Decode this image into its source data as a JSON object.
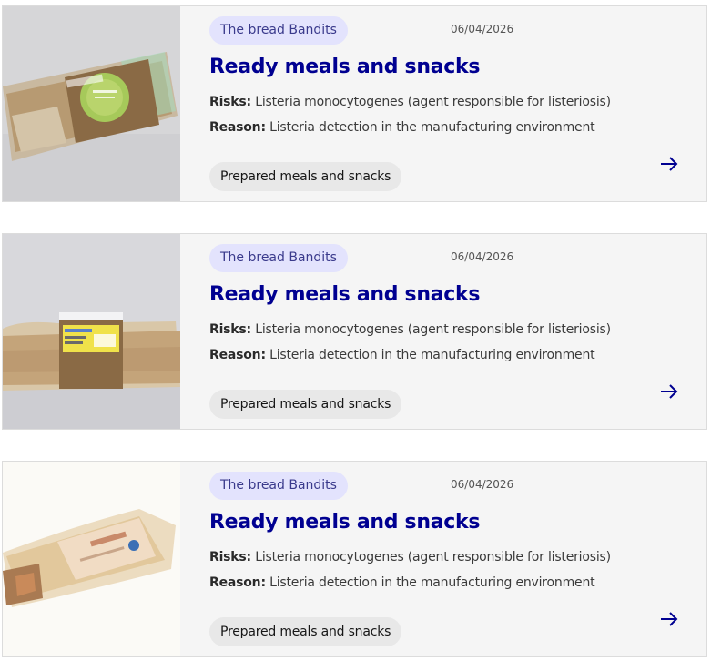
{
  "colors": {
    "card_bg": "#f5f5f5",
    "title": "#000091",
    "brand_badge_bg": "#e3e3fd",
    "tag_bg": "#e8e8e8"
  },
  "cards": [
    {
      "brand": "The bread Bandits",
      "date": "06/04/2026",
      "title": "Ready meals and snacks",
      "risks_label": "Risks:",
      "risks_text": " Listeria monocytogenes (agent responsible for listeriosis)",
      "reason_label": "Reason:",
      "reason_text": " Listeria detection in the manufacturing environment",
      "tag": "Prepared meals and snacks",
      "arrow_icon": "arrow-right-icon"
    },
    {
      "brand": "The bread Bandits",
      "date": "06/04/2026",
      "title": "Ready meals and snacks",
      "risks_label": "Risks:",
      "risks_text": " Listeria monocytogenes (agent responsible for listeriosis)",
      "reason_label": "Reason:",
      "reason_text": " Listeria detection in the manufacturing environment",
      "tag": "Prepared meals and snacks",
      "arrow_icon": "arrow-right-icon"
    },
    {
      "brand": "The bread Bandits",
      "date": "06/04/2026",
      "title": "Ready meals and snacks",
      "risks_label": "Risks:",
      "risks_text": " Listeria monocytogenes (agent responsible for listeriosis)",
      "reason_label": "Reason:",
      "reason_text": " Listeria detection in the manufacturing environment",
      "tag": "Prepared meals and snacks",
      "arrow_icon": "arrow-right-icon"
    }
  ]
}
